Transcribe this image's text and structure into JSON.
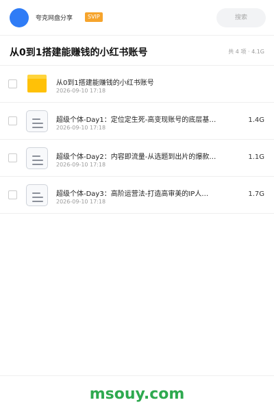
{
  "header": {
    "user_name": "夸克网盘分享",
    "badge": "SVIP",
    "search_placeholder": "搜索"
  },
  "share": {
    "title": "从0到1搭建能赚钱的小红书账号",
    "summary": "共 4 项 · 4.1G"
  },
  "files": [
    {
      "type": "folder",
      "icon": "folder-icon",
      "name": "从0到1搭建能赚钱的小红书账号",
      "date": "2026-09-10 17:18",
      "size": ""
    },
    {
      "type": "file",
      "icon": "document-icon",
      "name": "超级个体-Day1：定位定生死-高变现账号的底层基…",
      "date": "2026-09-10 17:18",
      "size": "1.4G"
    },
    {
      "type": "file",
      "icon": "document-icon",
      "name": "超级个体-Day2：内容即流量-从选题到出片的爆款…",
      "date": "2026-09-10 17:18",
      "size": "1.1G"
    },
    {
      "type": "file",
      "icon": "document-icon",
      "name": "超级个体-Day3：高阶运营法-打造高审美的IP人…",
      "date": "2026-09-10 17:18",
      "size": "1.7G"
    }
  ],
  "footer": {
    "watermark": "msouy.com"
  },
  "colors": {
    "brand_blue": "#2f7cf6",
    "svip_orange": "#f6a42c",
    "folder_yellow": "#ffc107",
    "watermark_green": "#2ea94f"
  }
}
